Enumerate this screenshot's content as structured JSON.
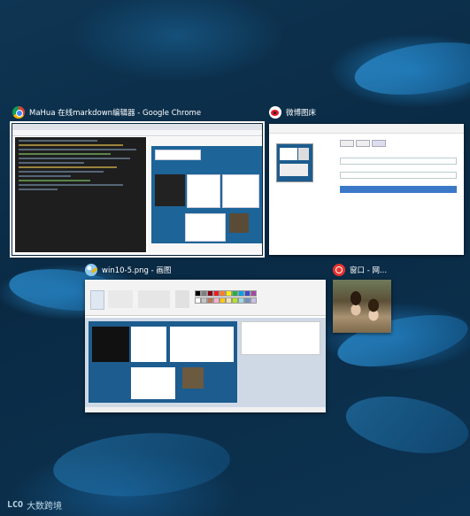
{
  "task_switcher": {
    "windows": [
      {
        "title": "MaHua 在线markdown编辑器 - Google Chrome",
        "icon": "chrome-icon",
        "selected": true
      },
      {
        "title": "微博图床",
        "icon": "weibo-icon",
        "selected": false
      },
      {
        "title": "win10-5.png - 画图",
        "icon": "paint-icon",
        "selected": false
      },
      {
        "title": "窗口 - 网...",
        "icon": "netease-music-icon",
        "selected": false
      }
    ]
  },
  "watermark": {
    "logo": "LCO",
    "text": "大数跨境"
  },
  "colors": {
    "desktop_bg": "#0b2f4b",
    "caption_text": "#ffffff",
    "selection_outline": "#ffffff",
    "chrome_red": "#db4437",
    "chrome_yellow": "#f4b400",
    "chrome_green": "#0f9d58",
    "weibo_red": "#e6162d",
    "netease_red": "#e8322e"
  }
}
